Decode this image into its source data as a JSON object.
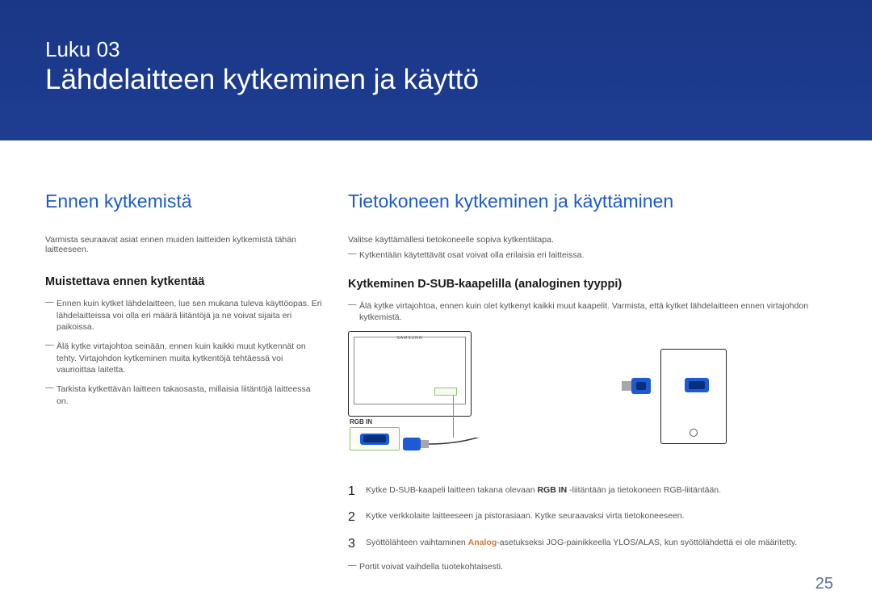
{
  "banner": {
    "chapter": "Luku 03",
    "title": "Lähdelaitteen kytkeminen ja käyttö"
  },
  "left": {
    "heading": "Ennen kytkemistä",
    "intro": "Varmista seuraavat asiat ennen muiden laitteiden kytkemistä tähän laitteeseen.",
    "subheading": "Muistettava ennen kytkentää",
    "notes": [
      "Ennen kuin kytket lähdelaitteen, lue sen mukana tuleva käyttöopas. Eri lähdelaitteissa voi olla eri määrä liitäntöjä ja ne voivat sijaita eri paikoissa.",
      "Älä kytke virtajohtoa seinään, ennen kuin kaikki muut kytkennät on tehty. Virtajohdon kytkeminen muita kytkentöjä tehtäessä voi vaurioittaa laitetta.",
      "Tarkista kytkettävän laitteen takaosasta, millaisia liitäntöjä laitteessa on."
    ]
  },
  "right": {
    "heading": "Tietokoneen kytkeminen ja käyttäminen",
    "intro": "Valitse käyttämällesi tietokoneelle sopiva kytkentätapa.",
    "note1": "Kytkentään käytettävät osat voivat olla erilaisia eri laitteissa.",
    "subheading": "Kytkeminen D-SUB-kaapelilla (analoginen tyyppi)",
    "note2": "Älä kytke virtajohtoa, ennen kuin olet kytkenyt kaikki muut kaapelit. Varmista, että kytket lähdelaitteen ennen virtajohdon kytkemistä.",
    "rgb_label": "RGB IN",
    "steps": [
      {
        "num": "1",
        "pre": "Kytke D-SUB-kaapeli laitteen takana olevaan ",
        "bold": "RGB IN",
        "post": " -liitäntään ja tietokoneen RGB-liitäntään."
      },
      {
        "num": "2",
        "pre": "Kytke verkkolaite laitteeseen ja pistorasiaan. Kytke seuraavaksi virta tietokoneeseen.",
        "bold": "",
        "post": ""
      },
      {
        "num": "3",
        "pre": "Syöttölähteen vaihtaminen ",
        "orange": "Analog",
        "post": "-asetukseksi JOG-painikkeella YLÖS/ALAS, kun syöttölähdettä ei ole määritetty."
      }
    ],
    "footnote": "Portit voivat vaihdella tuotekohtaisesti."
  },
  "page_number": "25"
}
